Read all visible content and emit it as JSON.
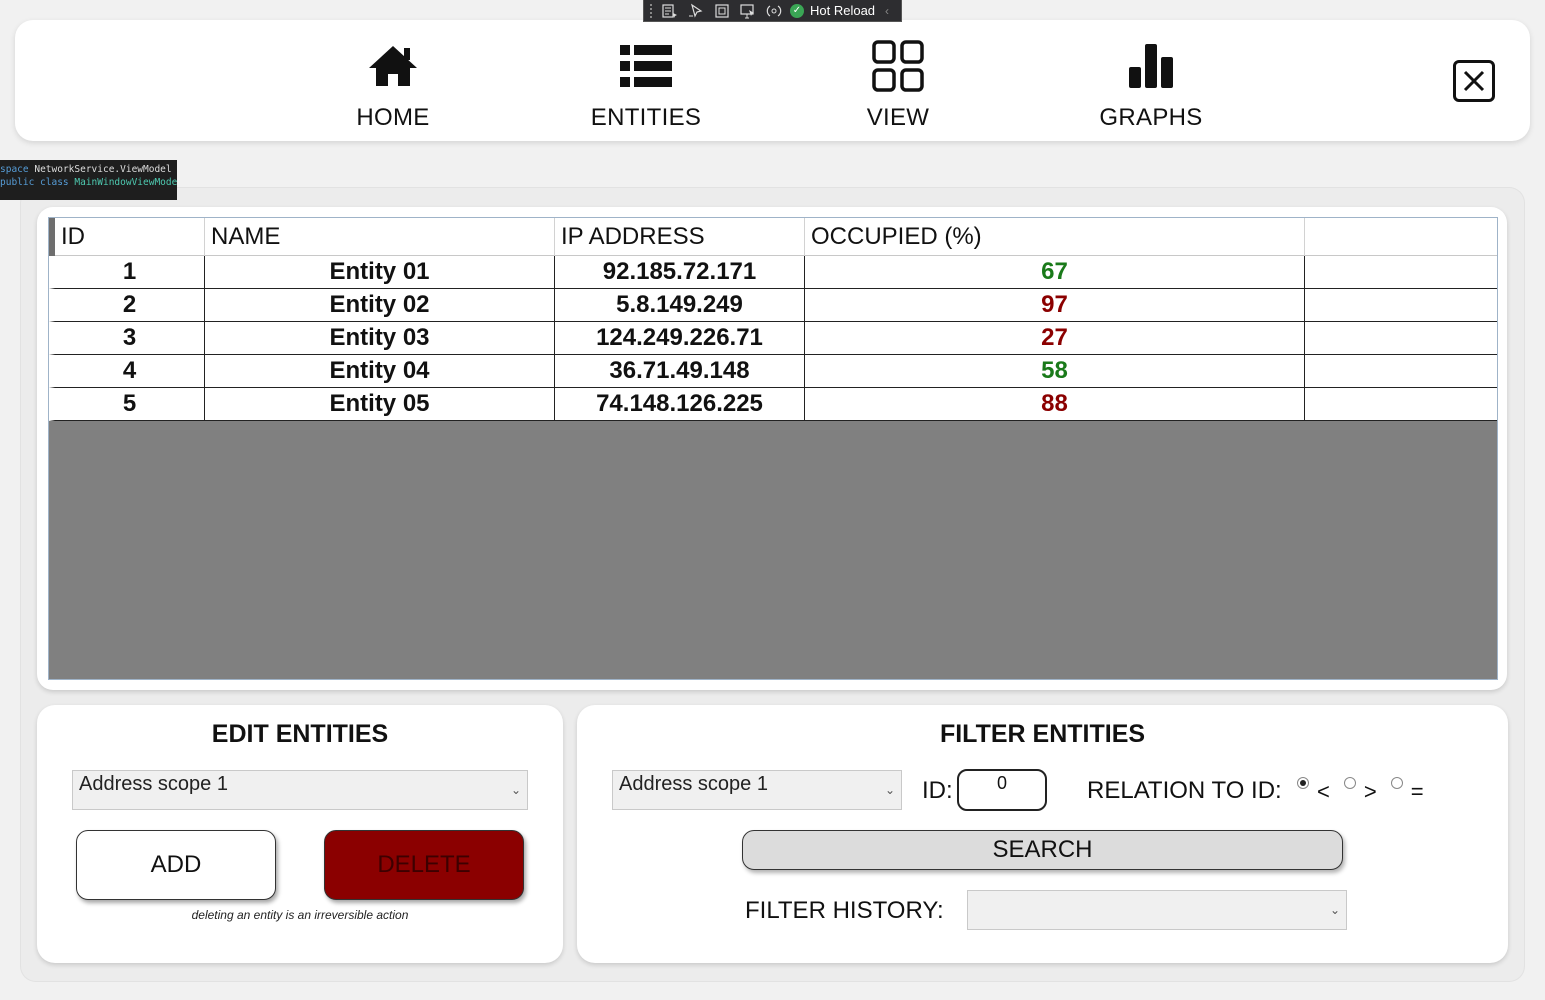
{
  "debug_toolbar": {
    "hot_reload_label": "Hot Reload"
  },
  "code_tooltip": {
    "line1_kw": "space",
    "line1_text": "NetworkService.ViewModel",
    "line2_kw": "public class",
    "line2_text": "MainWindowViewMode"
  },
  "nav": {
    "items": [
      {
        "label": "HOME",
        "icon": "home-icon"
      },
      {
        "label": "ENTITIES",
        "icon": "list-icon"
      },
      {
        "label": "VIEW",
        "icon": "grid-icon"
      },
      {
        "label": "GRAPHS",
        "icon": "bar-chart-icon"
      }
    ],
    "close_icon": "close-icon"
  },
  "table": {
    "headers": [
      "ID",
      "NAME",
      "IP ADDRESS",
      "OCCUPIED (%)",
      ""
    ],
    "rows": [
      {
        "id": "1",
        "name": "Entity 01",
        "ip": "92.185.72.171",
        "occupied": "67",
        "status_color": "#1a7a1a"
      },
      {
        "id": "2",
        "name": "Entity 02",
        "ip": "5.8.149.249",
        "occupied": "97",
        "status_color": "#8b0000"
      },
      {
        "id": "3",
        "name": "Entity 03",
        "ip": "124.249.226.71",
        "occupied": "27",
        "status_color": "#8b0000"
      },
      {
        "id": "4",
        "name": "Entity 04",
        "ip": "36.71.49.148",
        "occupied": "58",
        "status_color": "#1a7a1a"
      },
      {
        "id": "5",
        "name": "Entity 05",
        "ip": "74.148.126.225",
        "occupied": "88",
        "status_color": "#8b0000"
      }
    ]
  },
  "edit": {
    "title": "EDIT ENTITIES",
    "scope_value": "Address scope 1",
    "add_label": "ADD",
    "delete_label": "DELETE",
    "note": "deleting an entity is an irreversible action"
  },
  "filter": {
    "title": "FILTER ENTITIES",
    "scope_value": "Address scope 1",
    "id_label": "ID:",
    "id_value": "0",
    "relation_label": "RELATION TO ID:",
    "relations": [
      {
        "label": "<",
        "selected": true
      },
      {
        "label": ">",
        "selected": false
      },
      {
        "label": "=",
        "selected": false
      }
    ],
    "search_label": "SEARCH",
    "history_label": "FILTER HISTORY:",
    "history_value": ""
  },
  "colors": {
    "delete_bg": "#8b0000",
    "good": "#1a7a1a",
    "bad": "#8b0000"
  }
}
